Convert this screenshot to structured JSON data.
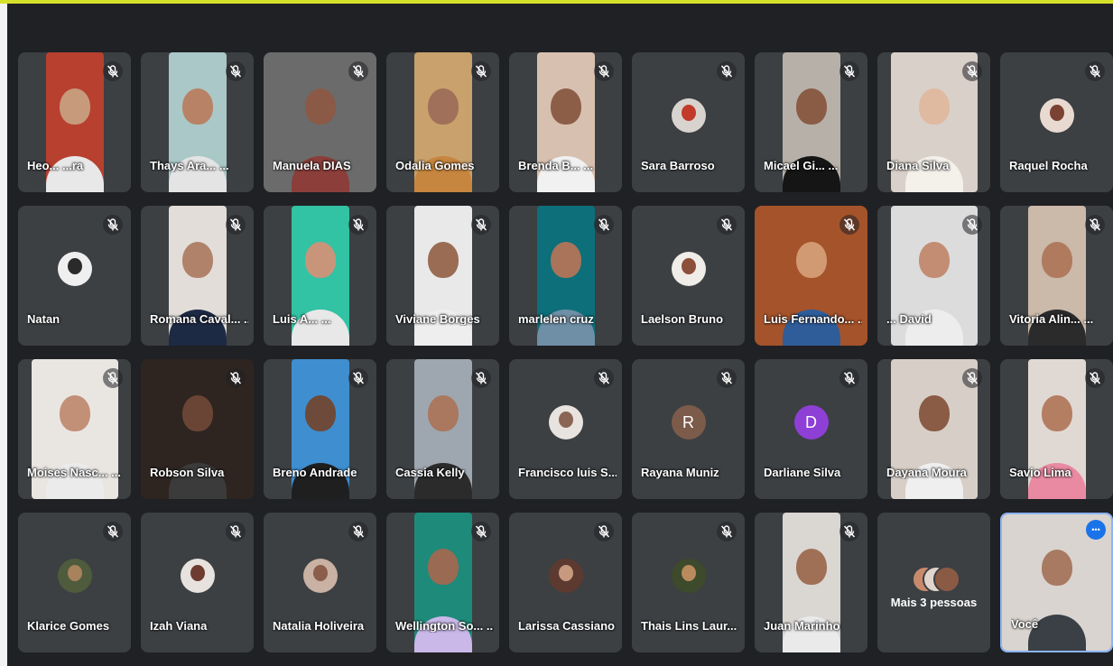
{
  "participants": [
    {
      "name": "Heo... ...ra",
      "kind": "video",
      "bg": "#b8402f",
      "skin": "#c79a7c",
      "shirt": "#e8e8e8"
    },
    {
      "name": "Thays Ara... ...",
      "kind": "video",
      "bg": "#a9c8c7",
      "skin": "#b88266",
      "shirt": "#e4e4e4"
    },
    {
      "name": "Manuela DIAS",
      "kind": "video",
      "bg": "#6b6b6b",
      "skin": "#8a5a46",
      "shirt": "#8b3e3a",
      "full": true
    },
    {
      "name": "Odalia Gomes",
      "kind": "video",
      "bg": "#c9a16c",
      "skin": "#a0705a",
      "shirt": "#c7863f"
    },
    {
      "name": "Brenda B... ...",
      "kind": "video",
      "bg": "#d8c0b0",
      "skin": "#8c5e48",
      "shirt": "#f1f1f1"
    },
    {
      "name": "Sara Barroso",
      "kind": "avatar",
      "avbg": "#d9d3cf",
      "avfg": "#c23a2a"
    },
    {
      "name": "Micael Gi... ...",
      "kind": "video",
      "bg": "#b6b0a8",
      "skin": "#8a5c45",
      "shirt": "#151515"
    },
    {
      "name": "Diana Silva",
      "kind": "video",
      "bg": "#d9d0c9",
      "skin": "#e0b9a1",
      "shirt": "#f4f0ea",
      "wide": true
    },
    {
      "name": "Raquel Rocha",
      "kind": "avatar",
      "avbg": "#e8dad1",
      "avfg": "#7a4232"
    },
    {
      "name": "Natan",
      "kind": "avatar",
      "avbg": "#efefef",
      "avfg": "#2a2a2a"
    },
    {
      "name": "Romana Caval... ...",
      "kind": "video",
      "bg": "#e2ddd8",
      "skin": "#b0826a",
      "shirt": "#1d2a44"
    },
    {
      "name": "Luis A... ...",
      "kind": "video",
      "bg": "#32c2a4",
      "skin": "#c9957a",
      "shirt": "#e8e8e8"
    },
    {
      "name": "Viviane Borges",
      "kind": "video",
      "bg": "#e9e9e9",
      "skin": "#9a6c54",
      "shirt": "#eeeeee"
    },
    {
      "name": "marlelen cruz",
      "kind": "video",
      "bg": "#0d6f7a",
      "skin": "#a97459",
      "shirt": "#6e8fa6"
    },
    {
      "name": "Laelson Bruno",
      "kind": "avatar",
      "avbg": "#f0ece8",
      "avfg": "#8c4f3a"
    },
    {
      "name": "Luis Fernando... ...",
      "kind": "video",
      "bg": "#a5532a",
      "skin": "#d19a72",
      "shirt": "#2f5d9a",
      "full": true
    },
    {
      "name": "... David",
      "kind": "video",
      "bg": "#dcdcdc",
      "skin": "#c38d73",
      "shirt": "#ededed",
      "wide": true
    },
    {
      "name": "Vitoria Alin... ...",
      "kind": "video",
      "bg": "#cbb9a9",
      "skin": "#b07a5f",
      "shirt": "#2b2b2b"
    },
    {
      "name": "Moises Nasc... ...",
      "kind": "video",
      "bg": "#e9e6e2",
      "skin": "#c28f77",
      "shirt": "#ebebeb",
      "wide": true
    },
    {
      "name": "Robson Silva",
      "kind": "video",
      "bg": "#2e2521",
      "skin": "#6a4536",
      "shirt": "#3b3b3b",
      "full": true
    },
    {
      "name": "Breno Andrade",
      "kind": "video",
      "bg": "#3f8ed0",
      "skin": "#6e4a3a",
      "shirt": "#1f1f1f"
    },
    {
      "name": "Cassia Kelly",
      "kind": "video",
      "bg": "#9ea7b0",
      "skin": "#a9785e",
      "shirt": "#2b2b2b"
    },
    {
      "name": "Francisco luis S... ...",
      "kind": "avatar",
      "avbg": "#e8e3df",
      "avfg": "#8a6554"
    },
    {
      "name": "Rayana Muniz",
      "kind": "letter",
      "letter": "R",
      "color": "#7c5b4a"
    },
    {
      "name": "Darliane Silva",
      "kind": "letter",
      "letter": "D",
      "color": "#8e3fd6"
    },
    {
      "name": "Dayana Moura",
      "kind": "video",
      "bg": "#d7cfc7",
      "skin": "#8a5b45",
      "shirt": "#efefef",
      "wide": true
    },
    {
      "name": "Savio Lima",
      "kind": "video",
      "bg": "#e0d9d3",
      "skin": "#b47e63",
      "shirt": "#e98aa2"
    },
    {
      "name": "Klarice Gomes",
      "kind": "avatar",
      "avbg": "#4e5b3c",
      "avfg": "#a8825c"
    },
    {
      "name": "Izah Viana",
      "kind": "avatar",
      "avbg": "#e7e2de",
      "avfg": "#6d3b30"
    },
    {
      "name": "Natalia Holiveira",
      "kind": "avatar",
      "avbg": "#c9b1a3",
      "avfg": "#8a5e4a"
    },
    {
      "name": "Wellington So... ...",
      "kind": "video",
      "bg": "#1e8a7a",
      "skin": "#9a6a52",
      "shirt": "#c9b8e8"
    },
    {
      "name": "Larissa Cassiano",
      "kind": "avatar",
      "avbg": "#5c3a30",
      "avfg": "#c79a80"
    },
    {
      "name": "Thais Lins Laur... ...",
      "kind": "avatar",
      "avbg": "#3d4a2b",
      "avfg": "#b88a5c"
    },
    {
      "name": "Juan Marinho",
      "kind": "video",
      "bg": "#dad6d2",
      "skin": "#9f6f56",
      "shirt": "#eaeaea"
    },
    {
      "name": "",
      "kind": "more",
      "label": "Mais 3 pessoas"
    },
    {
      "name": "Você",
      "kind": "self",
      "bg": "#d9d4cf",
      "skin": "#a87a62",
      "shirt": "#3a4046"
    }
  ],
  "icons": {
    "mic": "mic-off-icon",
    "options": "more-options-icon"
  }
}
